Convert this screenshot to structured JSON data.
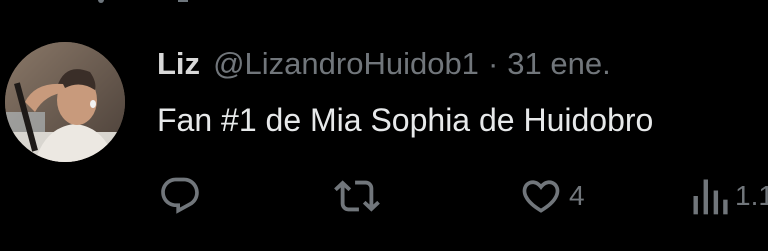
{
  "tweet": {
    "display_name": "Liz",
    "handle": "@LizandroHuidob1",
    "separator": "·",
    "timestamp": "31 ene.",
    "text": "Fan #1 de Mia Sophia de Huidobro"
  },
  "actions": {
    "reply_count": "",
    "retweet_count": "",
    "like_count": "4",
    "views_count": "1.1"
  },
  "icons": {
    "reply": "reply-icon",
    "retweet": "retweet-icon",
    "like": "heart-icon",
    "views": "views-icon"
  },
  "colors": {
    "background": "#000000",
    "primary_text": "#e7e9ea",
    "secondary_text": "#71767b"
  }
}
